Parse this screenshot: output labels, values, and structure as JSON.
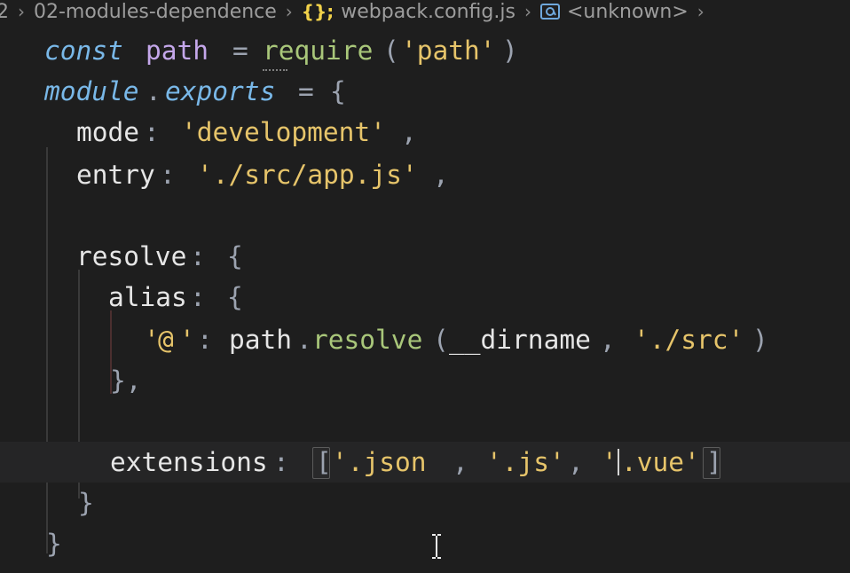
{
  "breadcrumb": {
    "prefix": "2",
    "folder": "02-modules-dependence",
    "file_icon_glyph": "{};",
    "file": "webpack.config.js",
    "symbol": "<unknown>"
  },
  "code": {
    "line1": {
      "const": "const",
      "path": "path",
      "equals": "=",
      "require": "require",
      "open": "(",
      "arg": "'path'",
      "close": ")"
    },
    "line2": {
      "module": "module",
      "dot": ".",
      "exports": "exports",
      "equals": "=",
      "brace": "{"
    },
    "line3": {
      "key": "mode",
      "colon": ":",
      "value": "'development'",
      "comma": ","
    },
    "line4": {
      "key": "entry",
      "colon": ":",
      "value": "'./src/app.js'",
      "comma": ","
    },
    "line6": {
      "key": "resolve",
      "colon": ":",
      "brace": "{"
    },
    "line7": {
      "key": "alias",
      "colon": ":",
      "brace": "{"
    },
    "line8": {
      "key_quote_open": "'",
      "key": "@",
      "key_quote_close": "'",
      "colon": ":",
      "obj": "path",
      "dot": ".",
      "fn": "resolve",
      "open": "(",
      "arg1": "__dirname",
      "comma": ",",
      "arg2": "'./src'",
      "close": ")"
    },
    "line9": {
      "close": "},"
    },
    "line11": {
      "key": "extensions",
      "colon": ":",
      "open": "[",
      "item1_prefix": "'.json",
      "comma1": ",",
      "item2": "'.js'",
      "comma2": ",",
      "item3_quote": "'",
      "item3_rest": ".vue'",
      "close": "]"
    },
    "line12": {
      "close": "}"
    },
    "line13": {
      "close": "}"
    }
  },
  "colors": {
    "background": "#1e1e1e",
    "keyword": "#79b8e8",
    "variable": "#c4a7ea",
    "function": "#a9c77a",
    "string": "#e6c46a",
    "punctuation": "#9ca3b0",
    "property": "#e6e6e6"
  }
}
